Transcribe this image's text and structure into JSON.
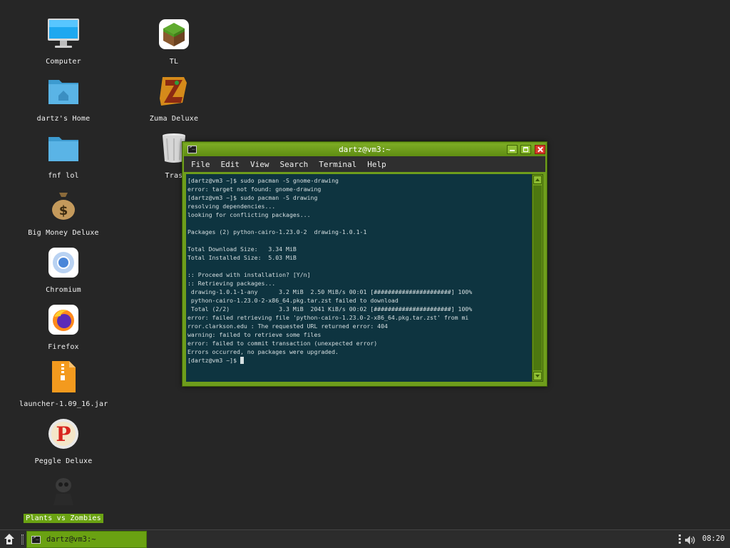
{
  "desktop": {
    "icons": [
      {
        "label": "Computer",
        "icon": "computer-icon"
      },
      {
        "label": "dartz's Home",
        "icon": "home-folder-icon"
      },
      {
        "label": "fnf lol",
        "icon": "folder-icon"
      },
      {
        "label": "Big Money Deluxe",
        "icon": "money-bag-icon"
      },
      {
        "label": "Chromium",
        "icon": "chromium-icon"
      },
      {
        "label": "Firefox",
        "icon": "firefox-icon"
      },
      {
        "label": "launcher-1.09_16.jar",
        "icon": "jar-archive-icon"
      },
      {
        "label": "Peggle Deluxe",
        "icon": "peggle-icon"
      },
      {
        "label": "Plants vs Zombies",
        "icon": "pvz-icon"
      },
      {
        "label": "TL",
        "icon": "minecraft-block-icon"
      },
      {
        "label": "Zuma Deluxe",
        "icon": "zuma-icon"
      },
      {
        "label": "Tras",
        "icon": "trash-icon"
      }
    ]
  },
  "terminal": {
    "title": "dartz@vm3:~",
    "menu": [
      "File",
      "Edit",
      "View",
      "Search",
      "Terminal",
      "Help"
    ],
    "lines": [
      "[dartz@vm3 ~]$ sudo pacman -S gnome-drawing",
      "error: target not found: gnome-drawing",
      "[dartz@vm3 ~]$ sudo pacman -S drawing",
      "resolving dependencies...",
      "looking for conflicting packages...",
      "",
      "Packages (2) python-cairo-1.23.0-2  drawing-1.0.1-1",
      "",
      "Total Download Size:   3.34 MiB",
      "Total Installed Size:  5.03 MiB",
      "",
      ":: Proceed with installation? [Y/n]",
      ":: Retrieving packages...",
      " drawing-1.0.1-1-any      3.2 MiB  2.50 MiB/s 00:01 [######################] 100%",
      " python-cairo-1.23.0-2-x86_64.pkg.tar.zst failed to download",
      " Total (2/2)              3.3 MiB  2041 KiB/s 00:02 [######################] 100%",
      "error: failed retrieving file 'python-cairo-1.23.0-2-x86_64.pkg.tar.zst' from mi",
      "rror.clarkson.edu : The requested URL returned error: 404",
      "warning: failed to retrieve some files",
      "error: failed to commit transaction (unexpected error)",
      "Errors occurred, no packages were upgraded.",
      "[dartz@vm3 ~]$ "
    ]
  },
  "taskbar": {
    "task_label": "dartz@vm3:~",
    "clock": "08:20"
  },
  "colors": {
    "accent": "#6aa212",
    "terminal_bg": "#0e3440",
    "desktop_bg": "#262626"
  }
}
